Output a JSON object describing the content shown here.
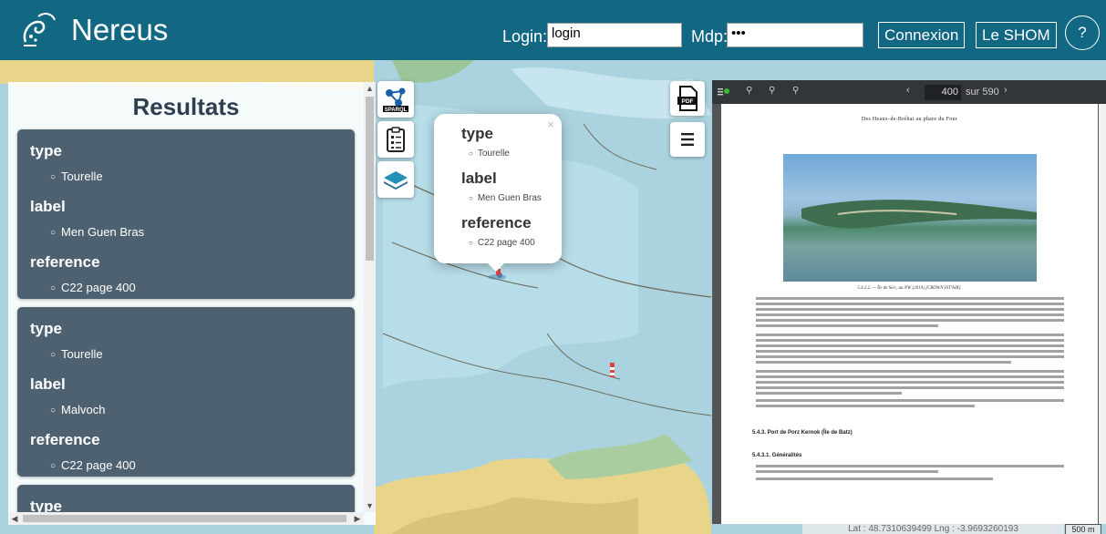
{
  "header": {
    "app_title": "Nereus",
    "login_label": "Login:",
    "login_value": "login",
    "password_label": "Mdp:",
    "password_value": "•••",
    "connect_button": "Connexion",
    "shom_button": "Le SHOM",
    "help_button": "?"
  },
  "results": {
    "title": "Resultats",
    "cards": [
      {
        "type_key": "type",
        "type_val": "Tourelle",
        "label_key": "label",
        "label_val": "Men Guen Bras",
        "ref_key": "reference",
        "ref_val": "C22 page 400"
      },
      {
        "type_key": "type",
        "type_val": "Tourelle",
        "label_key": "label",
        "label_val": "Malvoch",
        "ref_key": "reference",
        "ref_val": "C22 page 400"
      },
      {
        "type_key": "type"
      }
    ]
  },
  "tools": {
    "sparql_label": "SPARQL",
    "pdf_label": "PDF"
  },
  "popup": {
    "type_key": "type",
    "type_val": "Tourelle",
    "label_key": "label",
    "label_val": "Men Guen Bras",
    "ref_key": "reference",
    "ref_val": "C22 page 400",
    "close": "×"
  },
  "pdf_viewer": {
    "current_page": "400",
    "page_of": "sur 590",
    "heading": "Des Heaux-de-Bréhat au phare du Four",
    "caption": "5.4.2.2. — Île de Siec, au NW (2019) [CROWN IST'AIR].",
    "section_title": "5.4.3. Port de Porz Kernok (Île de Batz)",
    "subsection_title": "5.4.3.1. Généralités"
  },
  "status": {
    "coords": "Lat : 48.7310639499   Lng : -3.9693260193",
    "scale": "500 m"
  },
  "colors": {
    "header_bg": "#126883",
    "card_bg": "#4e6170",
    "sea": "#aad3df",
    "land": "#e8d58a"
  }
}
